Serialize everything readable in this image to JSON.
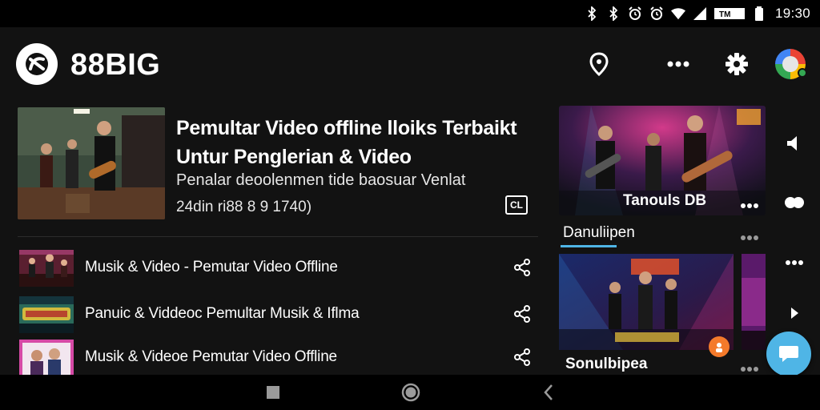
{
  "status_bar": {
    "time": "19:30",
    "icons": [
      "bluetooth-icon",
      "bluetooth-icon",
      "alarm-icon",
      "alarm-icon",
      "wifi-icon",
      "signal-icon",
      "battery-icon",
      "sim-icon"
    ]
  },
  "header": {
    "app_name": "88BIG",
    "logo_icon": "app-logo-icon",
    "actions": [
      "location-pin-icon",
      "more-horizontal-icon",
      "gear-icon",
      "avatar"
    ]
  },
  "featured": {
    "title": "Pemultar Video offline lloiks Terbaikt Untur Penglerian & Video",
    "description": "Penalar deoolenmen tide baosuar Venlat",
    "meta": "24din ri88 8 9 1740)",
    "cc_label": "CL"
  },
  "list": [
    {
      "title": "Musik & Video - Pemutar Video Offline",
      "thumb_color": "#8a2b44"
    },
    {
      "title": "Panuic & Viddeoc Pemultar Musik & Iflma",
      "thumb_color": "#1f4a55"
    },
    {
      "title": "Musik & Videoe Pemutar Video Offline",
      "thumb_color": "#d64aa6"
    }
  ],
  "right_panel": {
    "card_caption": "Tanouls DB",
    "section_title": "Danuliipen",
    "second_card_caption": "Sonulbipea"
  },
  "colors": {
    "background": "#121212",
    "accent": "#4fb5e6",
    "text": "#ffffff"
  }
}
